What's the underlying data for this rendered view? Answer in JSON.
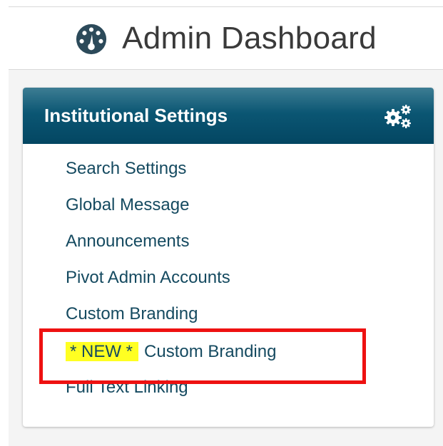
{
  "header": {
    "title": "Admin Dashboard",
    "icon": "dashboard-gauge-icon"
  },
  "panel": {
    "title": "Institutional Settings",
    "icon": "gears-icon",
    "header_color": "#0b5673",
    "links": [
      {
        "label": "Search Settings"
      },
      {
        "label": "Global Message"
      },
      {
        "label": "Announcements"
      },
      {
        "label": "Pivot Admin Accounts"
      },
      {
        "label": "Custom Branding"
      },
      {
        "badge": "* NEW *",
        "label": "Custom Branding"
      },
      {
        "label": "Full Text Linking"
      }
    ]
  },
  "annotation": {
    "highlight_color": "#ee1111",
    "badge_color": "#ffff22"
  }
}
